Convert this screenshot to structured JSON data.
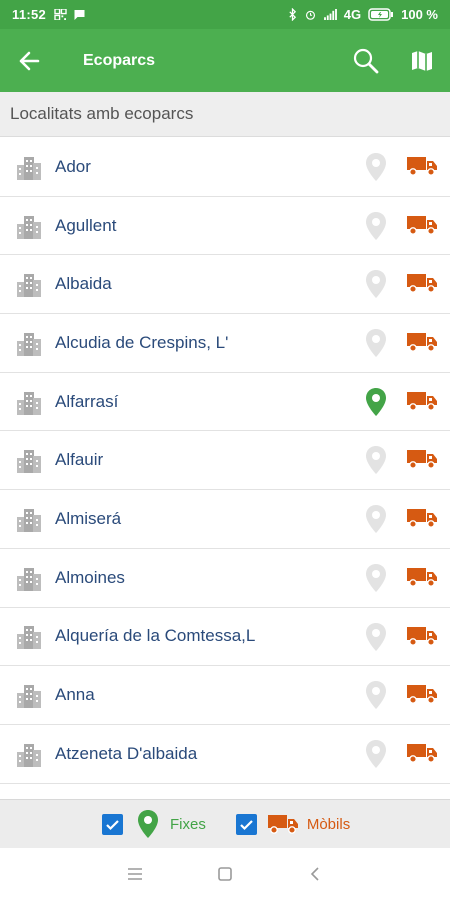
{
  "status_bar": {
    "time": "11:52",
    "network": "4G",
    "battery": "100 %"
  },
  "app_bar": {
    "title": "Ecoparcs",
    "back_icon": "arrow-left-icon",
    "search_icon": "search-icon",
    "map_icon": "map-icon"
  },
  "section_header": "Localitats amb ecoparcs",
  "localities": [
    {
      "name": "Ador",
      "fixed": false
    },
    {
      "name": "Agullent",
      "fixed": false
    },
    {
      "name": "Albaida",
      "fixed": false
    },
    {
      "name": "Alcudia de Crespins, L'",
      "fixed": false
    },
    {
      "name": "Alfarrasí",
      "fixed": true
    },
    {
      "name": "Alfauir",
      "fixed": false
    },
    {
      "name": "Almiserá",
      "fixed": false
    },
    {
      "name": "Almoines",
      "fixed": false
    },
    {
      "name": "Alquería de la Comtessa,L",
      "fixed": false
    },
    {
      "name": "Anna",
      "fixed": false
    },
    {
      "name": "Atzeneta D'albaida",
      "fixed": false
    }
  ],
  "filters": {
    "fixes_label": "Fixes",
    "fixes_checked": true,
    "mobils_label": "Mòbils",
    "mobils_checked": true
  },
  "colors": {
    "primary": "#4caf50",
    "status_bar": "#43a447",
    "pin_active": "#43a447",
    "pin_inactive": "#e3e3e3",
    "truck": "#d65a12",
    "checkbox": "#1976d2",
    "name_text": "#2a4a7a"
  }
}
